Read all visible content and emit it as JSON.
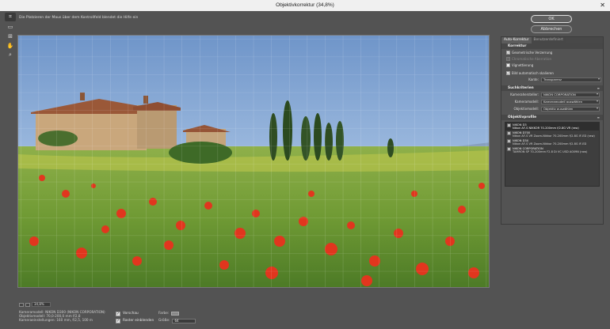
{
  "window": {
    "title": "Objektivkorrektur (34,8%)",
    "close_icon": "close-icon"
  },
  "tools": [
    {
      "name": "remove-distortion-tool",
      "icon": "distortion-icon"
    },
    {
      "name": "straighten-tool",
      "icon": "straighten-icon"
    },
    {
      "name": "move-grid-tool",
      "icon": "grid-move-icon"
    },
    {
      "name": "hand-tool",
      "icon": "hand-icon"
    },
    {
      "name": "zoom-tool",
      "icon": "zoom-icon"
    }
  ],
  "hint": "Die Platzieren der Maus über dem Kontrollfeld blendet die Hilfe ein",
  "zoom": {
    "value": "34,8%"
  },
  "camera_info": {
    "line1": "Kameramodell: NIKON D300 (NIKON CORPORATION)",
    "line2": "Objektivmodell: 70,0-200,0 mm f/2,8",
    "line3": "Kameraeinstellungen: 160 mm, f/2,5, 100 m"
  },
  "bottom_options": {
    "preview_label": "Vorschau",
    "show_grid_label": "Raster einblenden",
    "color_label": "Farbe:",
    "size_label": "Größe:",
    "size_value": "64"
  },
  "buttons": {
    "ok": "OK",
    "cancel": "Abbrechen"
  },
  "panel": {
    "tabs": [
      "Auto-Korrektur",
      "Benutzerdefiniert"
    ],
    "korrektur": {
      "title": "Korrektur",
      "items": [
        {
          "label": "Geometrische Verzerrung",
          "checked": true,
          "disabled": false
        },
        {
          "label": "Chromatische Aberration",
          "checked": false,
          "disabled": true
        },
        {
          "label": "Vignettierung",
          "checked": false,
          "disabled": false
        }
      ],
      "scale_label": "Bild automatisch skalieren",
      "edge_label": "Kante:",
      "edge_value": "Transparenz"
    },
    "suchkriterien": {
      "title": "Suchkriterien",
      "make_label": "Kamerahersteller:",
      "make_value": "NIKON CORPORATION",
      "model_label": "Kameramodell:",
      "model_value": "Kameramodell auswählen",
      "lens_label": "Objektivmodell:",
      "lens_value": "Objektiv auswählen"
    },
    "objektivprofile": {
      "title": "Objektivprofile",
      "items": [
        {
          "maker": "NIKON D3",
          "lens": "Nikon AF-S NIKKOR 70-200mm f/2.8G VR (raw)"
        },
        {
          "maker": "NIKON D700",
          "lens": "Nikon AF-S VR Zoom-Nikkor 70-200mm f/2.8G IF-ED (raw)"
        },
        {
          "maker": "NIKON D3X",
          "lens": "Nikon AF-S VR Zoom-Nikkor 70-200mm f/2.8G IF-ED"
        },
        {
          "maker": "NIKON CORPORATION",
          "lens": "TAMRON SP 70-200mm F2.8 Di VC USD A009N (raw)"
        }
      ]
    }
  },
  "colors": {
    "panel": "#535353",
    "canvas_border": "#777777",
    "grid": "#ffffff"
  }
}
